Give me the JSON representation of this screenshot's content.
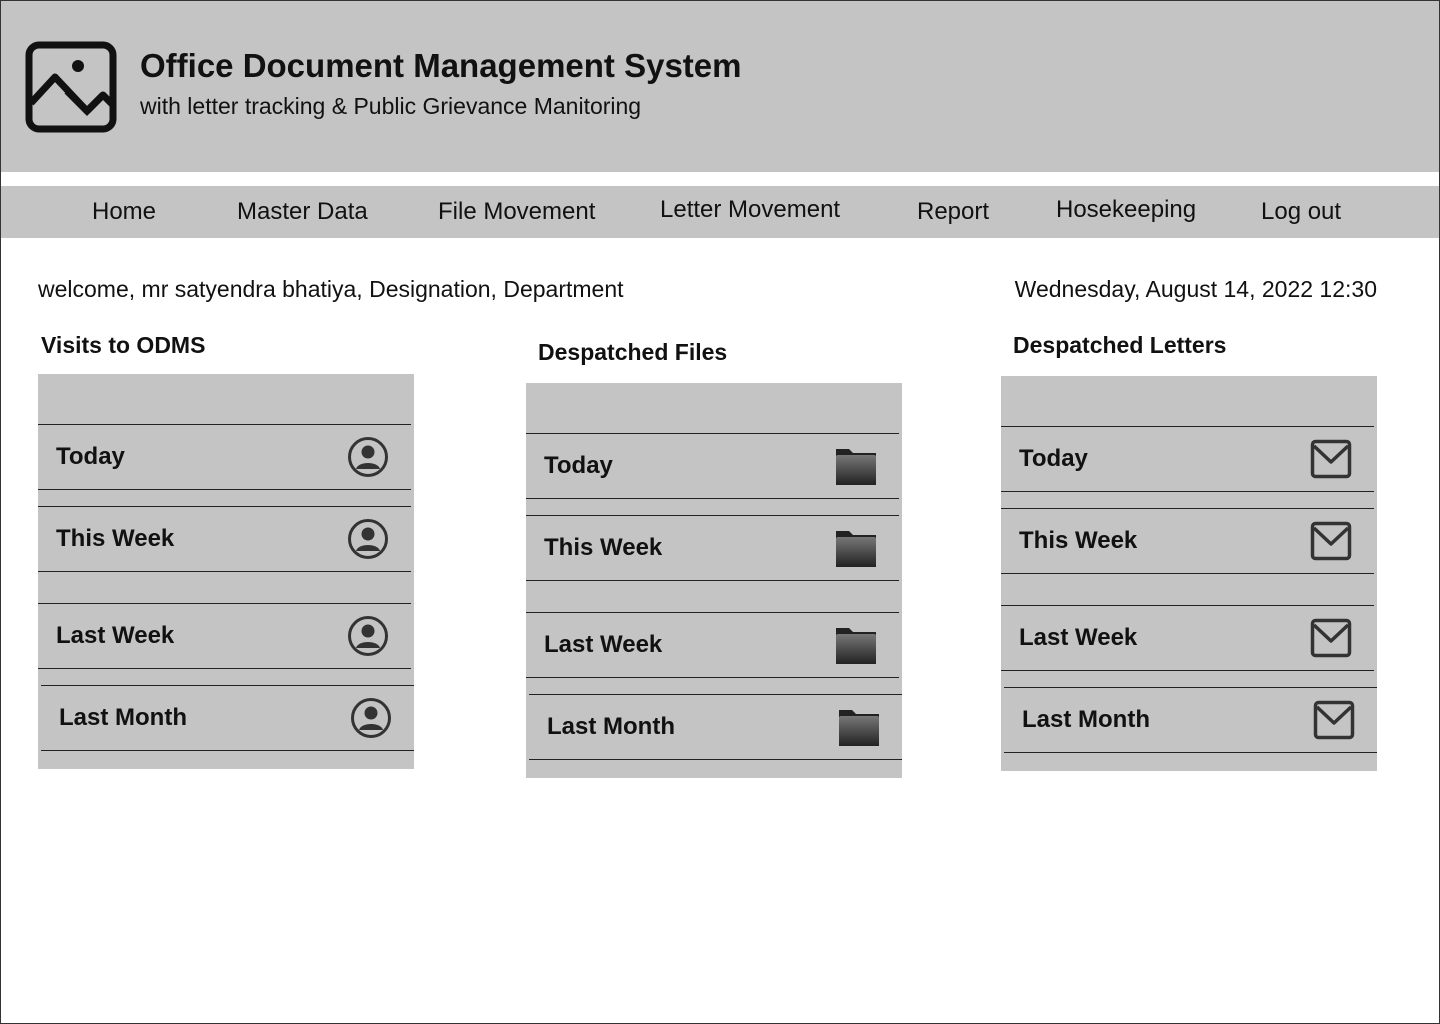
{
  "header": {
    "logo_icon": "image-placeholder-icon",
    "title": "Office Document Management System",
    "subtitle": "with letter tracking & Public Grievance Manitoring"
  },
  "nav": {
    "items": [
      {
        "label": "Home"
      },
      {
        "label": "Master Data"
      },
      {
        "label": "File Movement"
      },
      {
        "label": "Letter Movement"
      },
      {
        "label": "Report"
      },
      {
        "label": "Hosekeeping"
      },
      {
        "label": "Log out"
      }
    ]
  },
  "welcome": "welcome, mr satyendra bhatiya, Designation, Department",
  "datetime": "Wednesday, August 14, 2022 12:30",
  "panels": [
    {
      "title": "Visits to ODMS",
      "icon": "user-circle-icon",
      "rows": [
        {
          "label": "Today"
        },
        {
          "label": "This Week"
        },
        {
          "label": "Last Week"
        },
        {
          "label": "Last Month"
        }
      ]
    },
    {
      "title": "Despatched Files",
      "icon": "folder-icon",
      "rows": [
        {
          "label": "Today"
        },
        {
          "label": "This Week"
        },
        {
          "label": "Last Week"
        },
        {
          "label": "Last Month"
        }
      ]
    },
    {
      "title": "Despatched Letters",
      "icon": "envelope-icon",
      "rows": [
        {
          "label": "Today"
        },
        {
          "label": "This Week"
        },
        {
          "label": "Last Week"
        },
        {
          "label": "Last Month"
        }
      ]
    }
  ],
  "colors": {
    "panel_bg": "#c4c4c4",
    "icon_dark": "#333333"
  }
}
